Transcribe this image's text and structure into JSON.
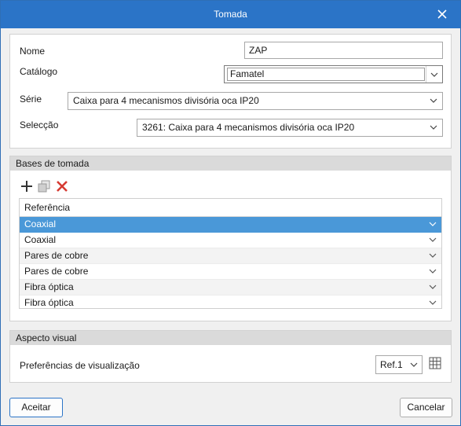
{
  "window": {
    "title": "Tomada"
  },
  "form": {
    "nome": {
      "label": "Nome",
      "value": "ZAP"
    },
    "catalogo": {
      "label": "Catálogo",
      "value": "Famatel"
    },
    "serie": {
      "label": "Série",
      "value": "Caixa para 4 mecanismos divisória oca IP20"
    },
    "seleccao": {
      "label": "Selecção",
      "value": "3261: Caixa para 4 mecanismos divisória oca IP20"
    }
  },
  "bases": {
    "header": "Bases de tomada",
    "toolbar": {
      "add_icon": "plus-icon",
      "copy_icon": "copy-icon",
      "delete_icon": "delete-icon"
    },
    "column_header": "Referência",
    "rows": [
      {
        "label": "Coaxial",
        "selected": true
      },
      {
        "label": "Coaxial",
        "selected": false
      },
      {
        "label": "Pares de cobre",
        "selected": false
      },
      {
        "label": "Pares de cobre",
        "selected": false
      },
      {
        "label": "Fibra óptica",
        "selected": false
      },
      {
        "label": "Fibra óptica",
        "selected": false
      }
    ]
  },
  "aspecto": {
    "header": "Aspecto visual",
    "pref_label": "Preferências de visualização",
    "ref_value": "Ref.1",
    "grid_icon": "table-grid-icon"
  },
  "buttons": {
    "accept": "Aceitar",
    "cancel": "Cancelar"
  },
  "colors": {
    "titlebar": "#2b74c7",
    "selection": "#4a98d8",
    "delete": "#d63b32"
  }
}
